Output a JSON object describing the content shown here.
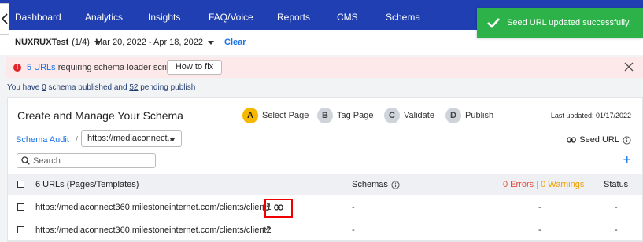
{
  "nav": {
    "items": [
      "Dashboard",
      "Analytics",
      "Insights",
      "FAQ/Voice",
      "Reports",
      "CMS",
      "Schema"
    ],
    "bg_color": "#1f3fb2"
  },
  "toast": {
    "message": "Seed URL updated successfully.",
    "color": "#2db24a",
    "icon": "check-icon"
  },
  "filters": {
    "account": "NUXRUXTest",
    "account_count": "(1/4)",
    "date_range": "Mar 20, 2022 - Apr 18, 2022",
    "clear_label": "Clear"
  },
  "alert": {
    "link_text": "5 URLs",
    "text": "requiring schema loader script",
    "button_label": "How to fix",
    "icon": "alert-icon"
  },
  "status": {
    "prefix": "You have",
    "published_count": "0",
    "middle": "schema published and",
    "pending_count": "52",
    "suffix": "pending publish"
  },
  "card": {
    "title": "Create and Manage Your Schema",
    "steps": [
      {
        "letter": "A",
        "label": "Select Page"
      },
      {
        "letter": "B",
        "label": "Tag Page"
      },
      {
        "letter": "C",
        "label": "Validate"
      },
      {
        "letter": "D",
        "label": "Publish"
      }
    ],
    "last_updated": "Last updated: 01/17/2022",
    "breadcrumb_root": "Schema Audit",
    "breadcrumb_sep": "/",
    "url_dropdown_value": "https://mediaconnect...",
    "seed_url_label": "Seed URL",
    "search_placeholder": "Search",
    "plus_label": "+"
  },
  "table": {
    "headers": {
      "urls": "6 URLs (Pages/Templates)",
      "schemas": "Schemas",
      "errors": "0 Errors",
      "sep": "|",
      "warnings": "0 Warnings",
      "status": "Status"
    },
    "rows": [
      {
        "url": "https://mediaconnect360.milestoneinternet.com/clients/client1",
        "schemas": "-",
        "errors": "-",
        "status": "-"
      },
      {
        "url": "https://mediaconnect360.milestoneinternet.com/clients/client2",
        "schemas": "-",
        "errors": "-",
        "status": "-"
      }
    ]
  }
}
